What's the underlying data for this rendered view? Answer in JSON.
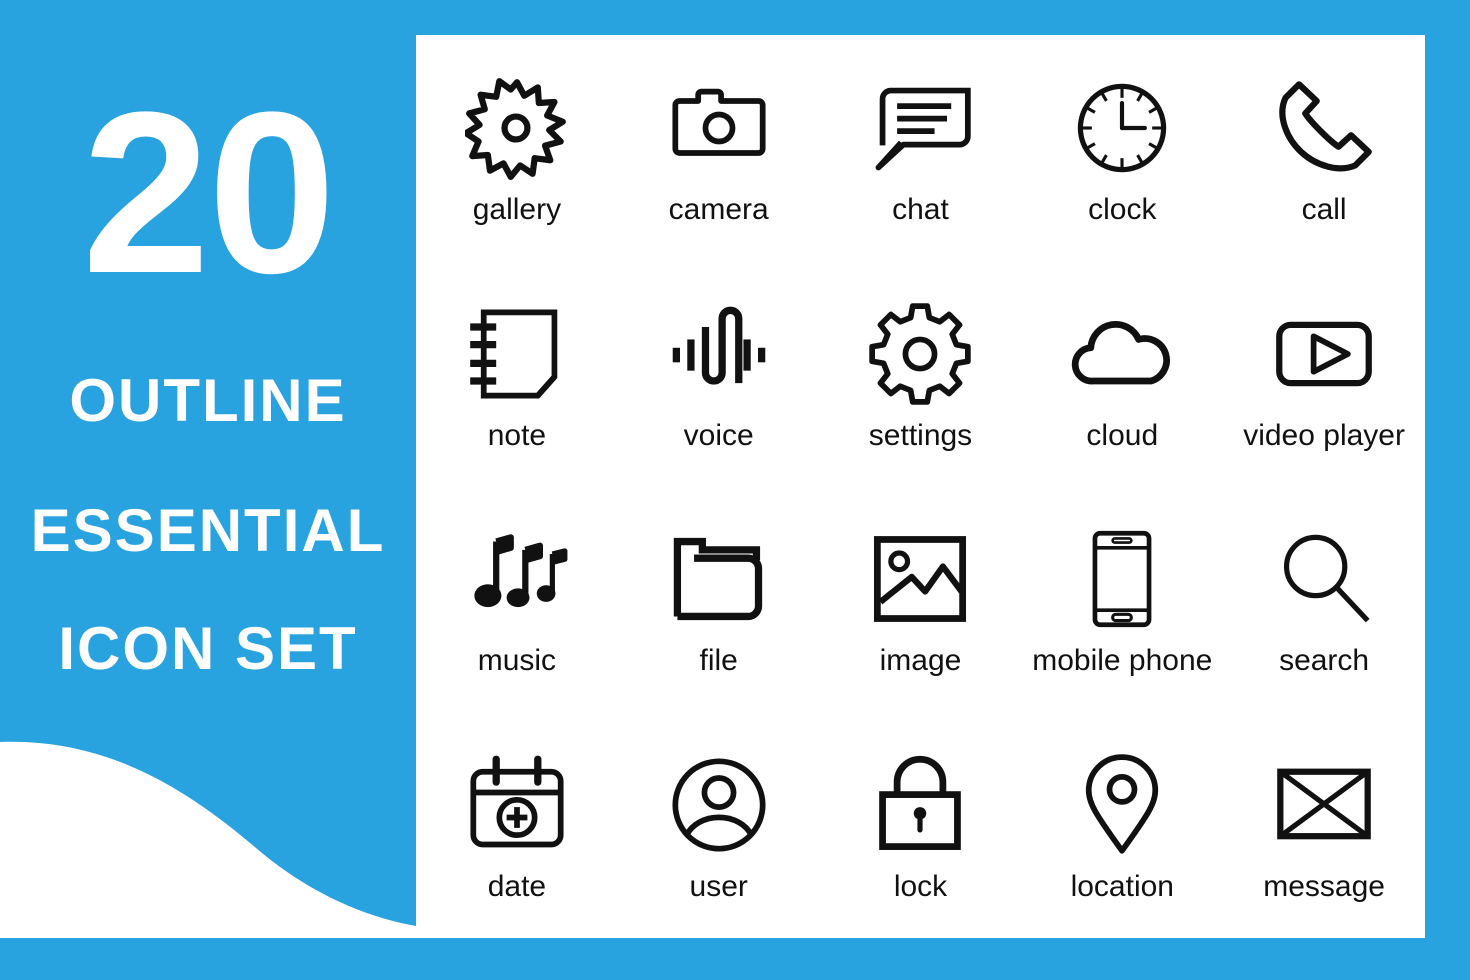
{
  "colors": {
    "brand_blue": "#29a3e0",
    "card_white": "#ffffff",
    "icon_black": "#111111"
  },
  "promo_panel": {
    "count": "20",
    "line1": "OUTLINE",
    "line2": "ESSENTIAL",
    "line3": "ICON SET"
  },
  "icons": [
    {
      "label": "gallery",
      "icon": "flower-icon"
    },
    {
      "label": "camera",
      "icon": "camera-icon"
    },
    {
      "label": "chat",
      "icon": "chat-bubble-icon"
    },
    {
      "label": "clock",
      "icon": "clock-icon"
    },
    {
      "label": "call",
      "icon": "phone-handset-icon"
    },
    {
      "label": "note",
      "icon": "notebook-icon"
    },
    {
      "label": "voice",
      "icon": "waveform-icon"
    },
    {
      "label": "settings",
      "icon": "gear-icon"
    },
    {
      "label": "cloud",
      "icon": "cloud-icon"
    },
    {
      "label": "video player",
      "icon": "play-rectangle-icon"
    },
    {
      "label": "music",
      "icon": "music-notes-icon"
    },
    {
      "label": "file",
      "icon": "folder-icon"
    },
    {
      "label": "image",
      "icon": "picture-frame-icon"
    },
    {
      "label": "mobile phone",
      "icon": "smartphone-icon"
    },
    {
      "label": "search",
      "icon": "magnifier-icon"
    },
    {
      "label": "date",
      "icon": "calendar-plus-icon"
    },
    {
      "label": "user",
      "icon": "user-avatar-icon"
    },
    {
      "label": "lock",
      "icon": "padlock-icon"
    },
    {
      "label": "location",
      "icon": "map-pin-icon"
    },
    {
      "label": "message",
      "icon": "envelope-icon"
    }
  ]
}
